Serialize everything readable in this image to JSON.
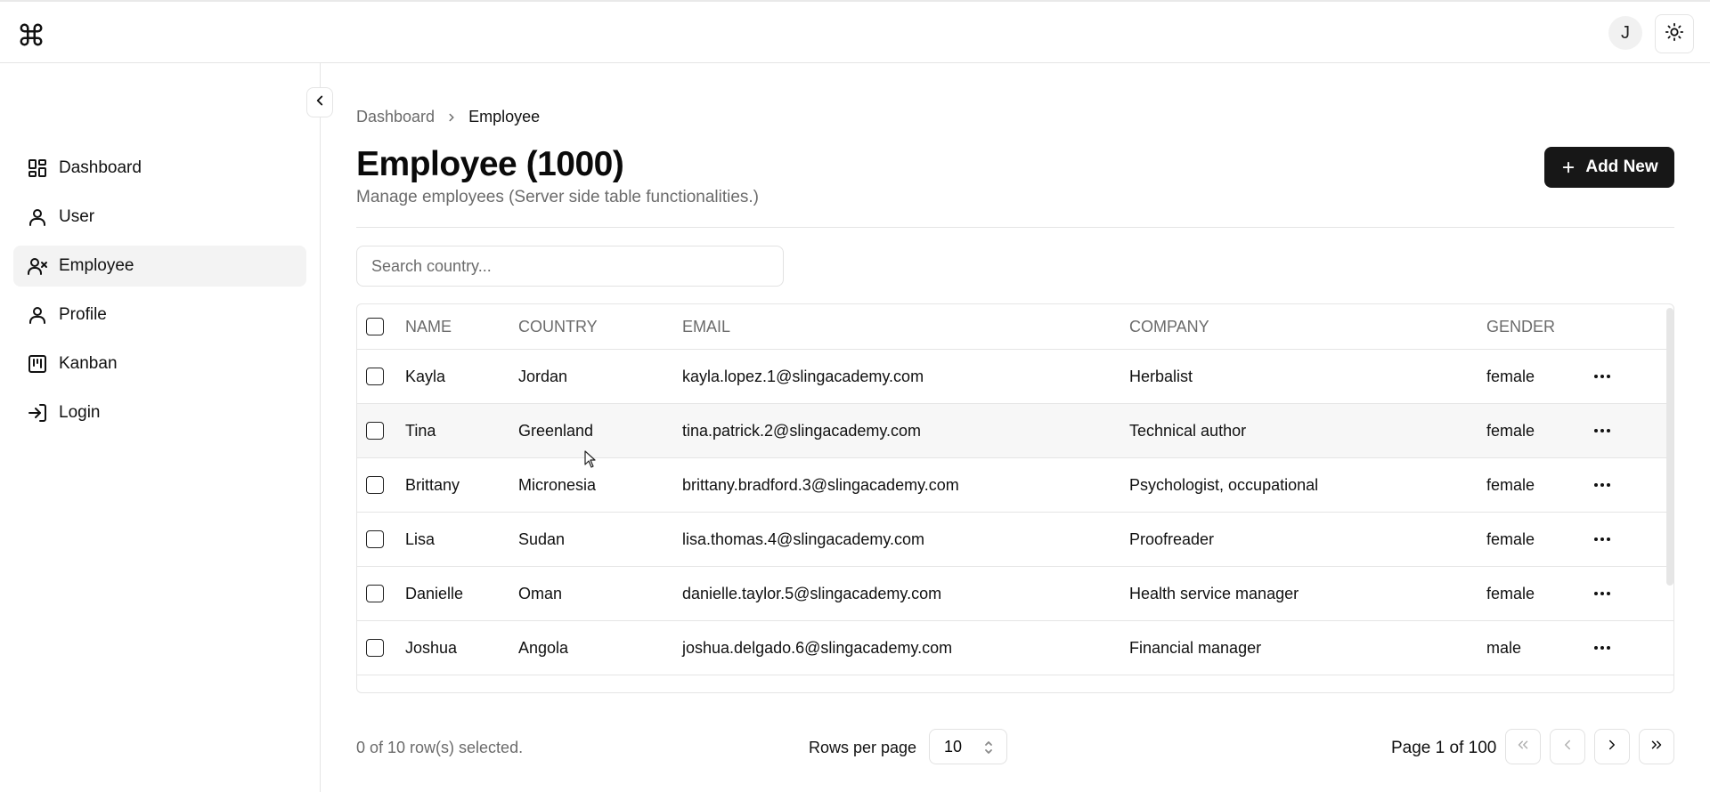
{
  "header": {
    "logo_icon": "command-icon",
    "avatar_initial": "J",
    "theme_icon": "sun-icon"
  },
  "sidebar": {
    "items": [
      {
        "label": "Dashboard",
        "icon": "dashboard-grid-icon",
        "active": false
      },
      {
        "label": "User",
        "icon": "user-icon",
        "active": false
      },
      {
        "label": "Employee",
        "icon": "user-x-icon",
        "active": true
      },
      {
        "label": "Profile",
        "icon": "user-icon",
        "active": false
      },
      {
        "label": "Kanban",
        "icon": "kanban-icon",
        "active": false
      },
      {
        "label": "Login",
        "icon": "log-in-icon",
        "active": false
      }
    ]
  },
  "main": {
    "breadcrumb": [
      "Dashboard",
      "Employee"
    ],
    "title": "Employee (1000)",
    "subtitle": "Manage employees (Server side table functionalities.)",
    "add_label": "Add New",
    "search_placeholder": "Search country...",
    "table": {
      "columns": [
        "NAME",
        "COUNTRY",
        "EMAIL",
        "COMPANY",
        "GENDER"
      ],
      "rows": [
        {
          "name": "Kayla",
          "country": "Jordan",
          "email": "kayla.lopez.1@slingacademy.com",
          "company": "Herbalist",
          "gender": "female"
        },
        {
          "name": "Tina",
          "country": "Greenland",
          "email": "tina.patrick.2@slingacademy.com",
          "company": "Technical author",
          "gender": "female"
        },
        {
          "name": "Brittany",
          "country": "Micronesia",
          "email": "brittany.bradford.3@slingacademy.com",
          "company": "Psychologist, occupational",
          "gender": "female"
        },
        {
          "name": "Lisa",
          "country": "Sudan",
          "email": "lisa.thomas.4@slingacademy.com",
          "company": "Proofreader",
          "gender": "female"
        },
        {
          "name": "Danielle",
          "country": "Oman",
          "email": "danielle.taylor.5@slingacademy.com",
          "company": "Health service manager",
          "gender": "female"
        },
        {
          "name": "Joshua",
          "country": "Angola",
          "email": "joshua.delgado.6@slingacademy.com",
          "company": "Financial manager",
          "gender": "male"
        }
      ]
    },
    "footer": {
      "selected_text": "0 of 10 row(s) selected.",
      "rows_per_page_label": "Rows per page",
      "rows_per_page_value": "10",
      "page_text": "Page 1 of 100"
    }
  }
}
